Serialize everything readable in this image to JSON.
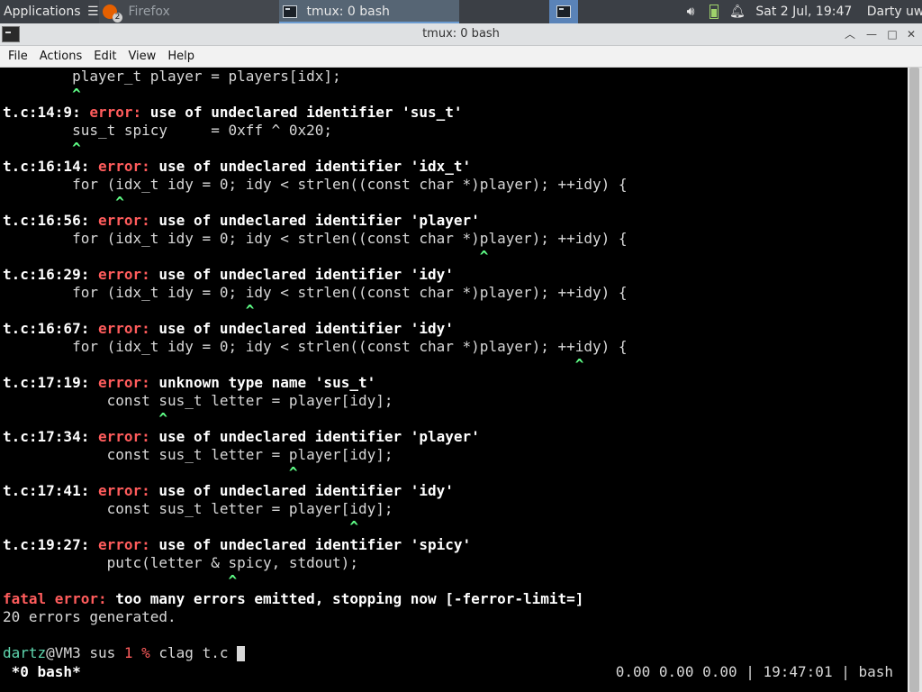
{
  "panel": {
    "applications_label": "Applications",
    "taskbar": [
      {
        "label": "Firefox",
        "badge": "2"
      },
      {
        "label": "tmux: 0 bash"
      }
    ],
    "datetime": "Sat  2 Jul, 19:47",
    "user": "Darty uwu"
  },
  "window": {
    "title": "tmux: 0 bash"
  },
  "menu": [
    "File",
    "Actions",
    "Edit",
    "View",
    "Help"
  ],
  "terminal": {
    "lines": [
      {
        "type": "code",
        "text": "        player_t player = players[idx];"
      },
      {
        "type": "caret",
        "text": "        ^"
      },
      {
        "type": "diag",
        "loc": "t.c:14:9: ",
        "kind": "error: ",
        "msg": "use of undeclared identifier 'sus_t'"
      },
      {
        "type": "code",
        "text": "        sus_t spicy     = 0xff ^ 0x20;"
      },
      {
        "type": "caret",
        "text": "        ^"
      },
      {
        "type": "diag",
        "loc": "t.c:16:14: ",
        "kind": "error: ",
        "msg": "use of undeclared identifier 'idx_t'"
      },
      {
        "type": "code",
        "text": "        for (idx_t idy = 0; idy < strlen((const char *)player); ++idy) {"
      },
      {
        "type": "caret",
        "text": "             ^"
      },
      {
        "type": "diag",
        "loc": "t.c:16:56: ",
        "kind": "error: ",
        "msg": "use of undeclared identifier 'player'"
      },
      {
        "type": "code",
        "text": "        for (idx_t idy = 0; idy < strlen((const char *)player); ++idy) {"
      },
      {
        "type": "caret",
        "text": "                                                       ^"
      },
      {
        "type": "diag",
        "loc": "t.c:16:29: ",
        "kind": "error: ",
        "msg": "use of undeclared identifier 'idy'"
      },
      {
        "type": "code",
        "text": "        for (idx_t idy = 0; idy < strlen((const char *)player); ++idy) {"
      },
      {
        "type": "caret",
        "text": "                            ^"
      },
      {
        "type": "diag",
        "loc": "t.c:16:67: ",
        "kind": "error: ",
        "msg": "use of undeclared identifier 'idy'"
      },
      {
        "type": "code",
        "text": "        for (idx_t idy = 0; idy < strlen((const char *)player); ++idy) {"
      },
      {
        "type": "caret",
        "text": "                                                                  ^"
      },
      {
        "type": "diag",
        "loc": "t.c:17:19: ",
        "kind": "error: ",
        "msg": "unknown type name 'sus_t'"
      },
      {
        "type": "code",
        "text": "            const sus_t letter = player[idy];"
      },
      {
        "type": "caret",
        "text": "                  ^"
      },
      {
        "type": "diag",
        "loc": "t.c:17:34: ",
        "kind": "error: ",
        "msg": "use of undeclared identifier 'player'"
      },
      {
        "type": "code",
        "text": "            const sus_t letter = player[idy];"
      },
      {
        "type": "caret",
        "text": "                                 ^"
      },
      {
        "type": "diag",
        "loc": "t.c:17:41: ",
        "kind": "error: ",
        "msg": "use of undeclared identifier 'idy'"
      },
      {
        "type": "code",
        "text": "            const sus_t letter = player[idy];"
      },
      {
        "type": "caret",
        "text": "                                        ^"
      },
      {
        "type": "diag",
        "loc": "t.c:19:27: ",
        "kind": "error: ",
        "msg": "use of undeclared identifier 'spicy'"
      },
      {
        "type": "code",
        "text": "            putc(letter & spicy, stdout);"
      },
      {
        "type": "caret",
        "text": "                          ^"
      },
      {
        "type": "fatal",
        "kind": "fatal error: ",
        "msg": "too many errors emitted, stopping now [-ferror-limit=]"
      },
      {
        "type": "code",
        "text": "20 errors generated."
      },
      {
        "type": "blank",
        "text": ""
      }
    ],
    "prompt": {
      "user": "dartz",
      "host": "@VM3 sus ",
      "status": "1 % ",
      "command": "clag t.c "
    },
    "statusbar": {
      "window": " *0 bash*",
      "right": "0.00 0.00 0.00 | 19:47:01 | bash"
    }
  }
}
